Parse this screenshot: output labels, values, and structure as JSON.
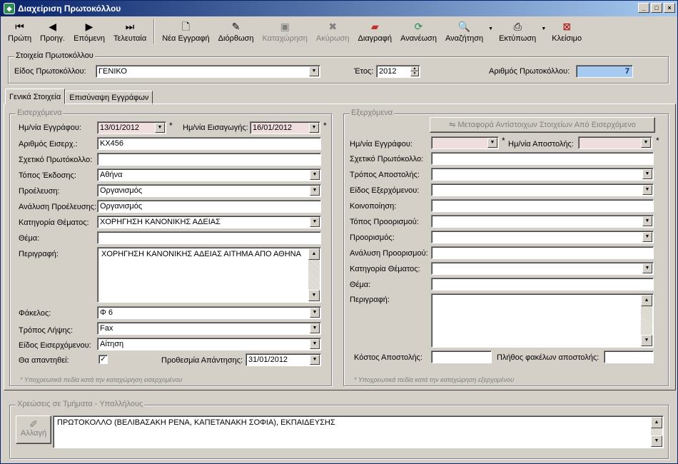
{
  "window": {
    "title": "Διαχείριση Πρωτοκόλλου",
    "controls": [
      "_",
      "□",
      "×"
    ]
  },
  "toolbar": {
    "first": "Πρώτη",
    "prev": "Προηγ.",
    "next": "Επόμενη",
    "last": "Τελευταία",
    "new_record": "Νέα Εγγραφή",
    "edit": "Διόρθωση",
    "save": "Καταχώρηση",
    "cancel": "Ακύρωση",
    "delete": "Διαγραφή",
    "refresh": "Ανανέωση",
    "search": "Αναζήτηση",
    "print": "Εκτύπωση",
    "close": "Κλείσιμο"
  },
  "protocol": {
    "legend": "Στοιχεία Πρωτοκόλλου",
    "type_label": "Είδος Πρωτοκόλλου:",
    "type_value": "ΓΕΝΙΚΟ",
    "year_label": "Έτος:",
    "year_value": "2012",
    "number_label": "Αριθμός Πρωτοκόλλου:",
    "number_value": "7"
  },
  "tabs": {
    "general": "Γενικά Στοιχεία",
    "attach": "Επισύναψη Εγγράφων"
  },
  "incoming": {
    "legend": "Εισερχόμενα",
    "doc_date_label": "Ημ/νία Εγγράφου:",
    "doc_date_value": "13/01/2012",
    "entry_date_label": "Ημ/νία Εισαγωγής:",
    "entry_date_value": "16/01/2012",
    "number_label": "Αριθμός Εισερχ.:",
    "number_value": "ΚΧ456",
    "related_label": "Σχετικό Πρωτόκολλο:",
    "related_value": "",
    "place_label": "Τόπος Έκδοσης:",
    "place_value": "Αθήνα",
    "origin_label": "Προέλευση:",
    "origin_value": "Οργανισμός",
    "origin_detail_label": "Ανάλυση Προέλευσης:",
    "origin_detail_value": "Οργανισμός",
    "category_label": "Κατηγορία Θέματος:",
    "category_value": "ΧΟΡΗΓΗΣΗ ΚΑΝΟΝΙΚΗΣ ΑΔΕΙΑΣ",
    "subject_label": "Θέμα:",
    "subject_value": "",
    "description_label": "Περιγραφή:",
    "description_value": "ΧΟΡΗΓΗΣΗ ΚΑΝΟΝΙΚΗΣ ΑΔΕΙΑΣ ΑΙΤΗΜΑ ΑΠΟ ΑΘΗΝΑ",
    "folder_label": "Φάκελος:",
    "folder_value": "Φ 6",
    "receipt_label": "Τρόπος Λήψης:",
    "receipt_value": "Fax",
    "kind_label": "Είδος Εισερχόμενου:",
    "kind_value": "Αίτηση",
    "reply_label": "Θα απαντηθεί:",
    "reply_checked": "✓",
    "deadline_label": "Προθεσμία Απάντησης:",
    "deadline_value": "31/01/2012",
    "note": "* Υποχρεωτικά πεδία κατά την καταχώρηση εισερχομένου"
  },
  "outgoing": {
    "legend": "Εξερχόμενα",
    "transfer_button": "Μεταφορά Αντίστοιχων Στοιχείων Από Εισερχόμενο",
    "doc_date_label": "Ημ/νία Εγγράφου:",
    "send_date_label": "Ημ/νία Αποστολής:",
    "related_label": "Σχετικό Πρωτόκολλο:",
    "send_method_label": "Τρόπος Αποστολής:",
    "kind_label": "Είδος Εξερχόμενου:",
    "notify_label": "Κοινοποίηση:",
    "dest_place_label": "Τόπος Προορισμού:",
    "dest_label": "Προορισμός:",
    "dest_detail_label": "Ανάλυση Προορισμού:",
    "category_label": "Κατηγορία Θέματος:",
    "subject_label": "Θέμα:",
    "description_label": "Περιγραφή:",
    "cost_label": "Κόστος Αποστολής:",
    "folders_label": "Πλήθος φακέλων αποστολής:",
    "note": "* Υποχρεωτικά πεδία κατά την καταχώρηση εξερχομένου"
  },
  "charges": {
    "legend": "Χρεώσεις σε Τμήματα - Υπαλλήλους",
    "change_button": "Αλλαγή",
    "value": "ΠΡΩΤΟΚΟΛΛΟ (ΒΕΛΙΒΑΣΑΚΗ ΡΕΝΑ, ΚΑΠΕΤΑΝΑΚΗ ΣΟΦΙΑ), ΕΚΠΑΙΔΕΥΣΗΣ"
  },
  "icons": {
    "first": "first-record-icon",
    "prev": "prev-record-icon",
    "next": "next-record-icon",
    "last": "last-record-icon"
  }
}
